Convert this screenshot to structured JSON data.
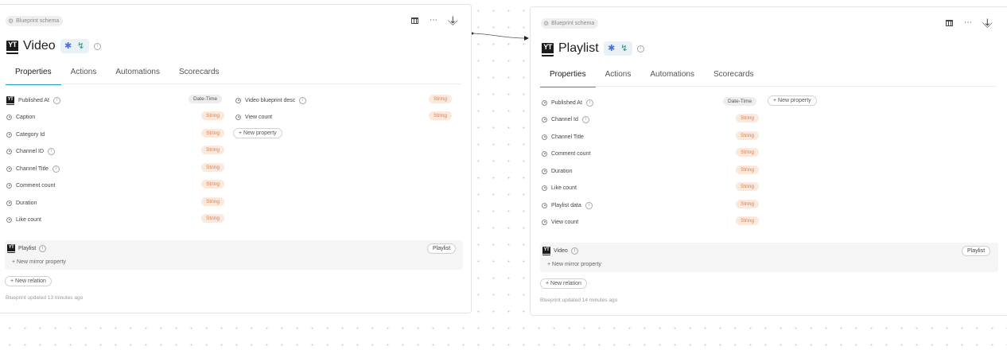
{
  "video": {
    "badge": "Blueprint schema",
    "logo": "YT",
    "title": "Video",
    "tabs": [
      "Properties",
      "Actions",
      "Automations",
      "Scorecards"
    ],
    "props_left": [
      {
        "name": "Published At",
        "type": "Date-Time"
      },
      {
        "name": "Caption",
        "type": "String"
      },
      {
        "name": "Category Id",
        "type": "String"
      },
      {
        "name": "Channel ID",
        "type": "String"
      },
      {
        "name": "Channel Title",
        "type": "String"
      },
      {
        "name": "Comment count",
        "type": "String"
      },
      {
        "name": "Duration",
        "type": "String"
      },
      {
        "name": "Like count",
        "type": "String"
      }
    ],
    "props_right": [
      {
        "name": "Video blueprint desc",
        "type": "String"
      },
      {
        "name": "View count",
        "type": "String"
      }
    ],
    "new_property": "New property",
    "relation": {
      "logo": "YT",
      "name": "Playlist",
      "target": "Playlist",
      "mirror": "New mirror property"
    },
    "new_relation": "New relation",
    "updated": "Blueprint updated 13 minutes ago"
  },
  "playlist": {
    "badge": "Blueprint schema",
    "logo": "YT",
    "title": "Playlist",
    "tabs": [
      "Properties",
      "Actions",
      "Automations",
      "Scorecards"
    ],
    "props": [
      {
        "name": "Published At",
        "type": "Date-Time"
      },
      {
        "name": "Channel Id",
        "type": "String"
      },
      {
        "name": "Channel Title",
        "type": "String"
      },
      {
        "name": "Comment count",
        "type": "String"
      },
      {
        "name": "Duration",
        "type": "String"
      },
      {
        "name": "Like count",
        "type": "String"
      },
      {
        "name": "Playlist data",
        "type": "String"
      },
      {
        "name": "View count",
        "type": "String"
      }
    ],
    "new_property": "New property",
    "relation": {
      "logo": "YT",
      "name": "Video",
      "target": "Playlist",
      "mirror": "New mirror property"
    },
    "new_relation": "New relation",
    "updated": "Blueprint updated 14 minutes ago"
  },
  "colors": {
    "accent_tab": "#2aa3c7",
    "string_pill_bg": "#fde8dc",
    "string_pill_text": "#d9814f"
  },
  "icons": {
    "table": "table-icon",
    "more": "more-icon",
    "collapse": "collapse-icon",
    "gear": "gear-icon",
    "info": "info-icon",
    "radio": "property-radio-icon"
  }
}
